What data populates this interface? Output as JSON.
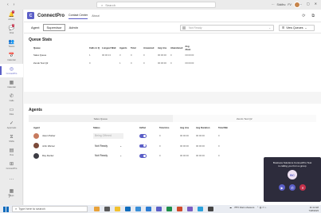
{
  "titlebar": {
    "search_placeholder": "Search",
    "user_name": "Siddhu",
    "status_text": "FV"
  },
  "rail": [
    {
      "label": "Activity",
      "glyph": "🔔",
      "badge": "1"
    },
    {
      "label": "Chat",
      "glyph": "💬",
      "badge": "1"
    },
    {
      "label": "Teams",
      "glyph": "👥",
      "badge": ""
    },
    {
      "label": "Calendar",
      "glyph": "📅",
      "badge": ""
    },
    {
      "label": "ConnectPro",
      "glyph": "◎",
      "badge": ""
    },
    {
      "label": "Calendar",
      "glyph": "▦",
      "badge": ""
    },
    {
      "label": "Calls",
      "glyph": "✆",
      "badge": ""
    },
    {
      "label": "Files",
      "glyph": "▭",
      "badge": ""
    },
    {
      "label": "Approvals",
      "glyph": "✓",
      "badge": ""
    },
    {
      "label": "Shifts",
      "glyph": "⧖",
      "badge": ""
    },
    {
      "label": "Viva",
      "glyph": "▤",
      "badge": ""
    },
    {
      "label": "ConnectPro",
      "glyph": "⊞",
      "badge": ""
    },
    {
      "label": "",
      "glyph": "…",
      "badge": ""
    },
    {
      "label": "Apps",
      "glyph": "▦",
      "badge": ""
    }
  ],
  "app": {
    "name": "ConnectPro",
    "tab_active": "Contact Center",
    "tab_other": "About",
    "logo": "C"
  },
  "subnav": {
    "tabs": [
      "Agent",
      "Supervisor",
      "Admin"
    ],
    "selected_index": 1,
    "status_placeholder": "Not Ready",
    "view_button": "View Queues"
  },
  "queue_stats": {
    "title": "Queue Stats",
    "columns": [
      "Queue",
      "Calls in Q",
      "Longest Wait",
      "Agents",
      "Total",
      "Answered",
      "Avg Ans",
      "Abandoned",
      "Avg Aban"
    ],
    "rows": [
      [
        "Sales Queue",
        "1",
        "00:00:13",
        "3",
        "0",
        "0",
        "00:00:00",
        "0",
        "00:00:00"
      ],
      [
        "Zendo Test Q2",
        "0",
        "",
        "1",
        "0",
        "0",
        "00:00:00",
        "0",
        "00:00:00"
      ]
    ]
  },
  "agents": {
    "title": "Agents",
    "queue_tabs": [
      "Sales Queue",
      "Zendo Test Q2"
    ],
    "columns": [
      "Agent",
      "Status",
      "In/Out",
      "Total Ans",
      "Avg Ans",
      "Avg Duration",
      "Total Min"
    ],
    "rows": [
      {
        "name": "Jason Parker",
        "status": "Being Offered",
        "status_disabled": true,
        "total": "0",
        "avg_ans": "00:00:00",
        "avg_dur": "00:00:00",
        "total_min": "0",
        "avatar": "#c77a5e"
      },
      {
        "name": "John Warner",
        "status": "Not Ready",
        "status_disabled": false,
        "total": "0",
        "avg_ans": "00:00:00",
        "avg_dur": "00:00:00",
        "total_min": "0",
        "avatar": "#7b4a3a"
      },
      {
        "name": "Ray Decker",
        "status": "Not Ready",
        "status_disabled": false,
        "total": "0",
        "avg_ans": "00:00:00",
        "avg_dur": "00:00:00",
        "total_min": "0",
        "avatar": "#3c3c44"
      }
    ]
  },
  "toast": {
    "line1": "Business Solutions ConnectPro Test",
    "line2": "is calling you from a group",
    "initials": "BC"
  },
  "taskbar": {
    "search": "Type here to search",
    "weather": "78°F  Rain showers",
    "time": "11:11 AM",
    "date": "7/28/2023"
  }
}
